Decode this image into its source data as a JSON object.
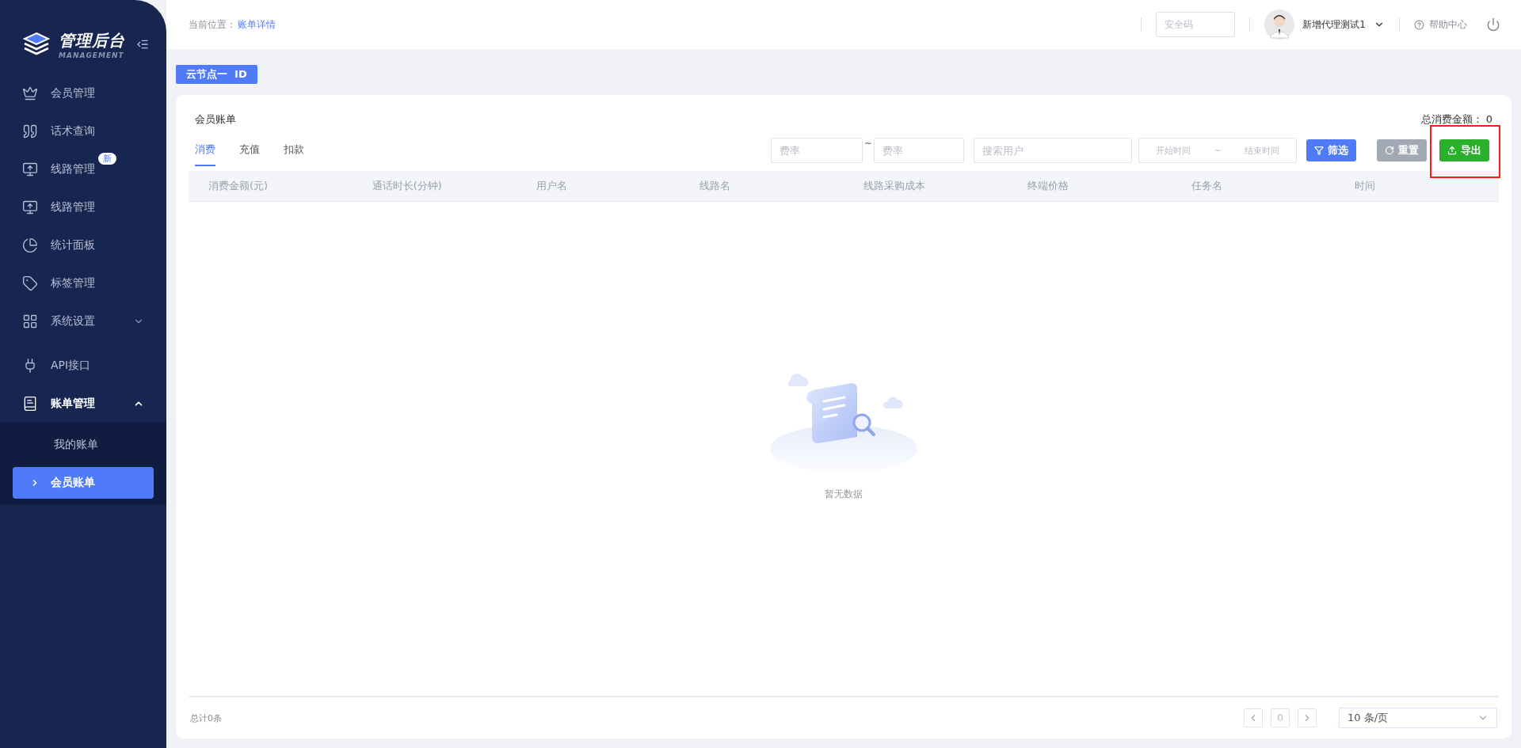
{
  "sidebar": {
    "logo": {
      "title": "管理后台",
      "subtitle": "MANAGEMENT"
    },
    "items": [
      {
        "kind": "link",
        "label": "会员管理",
        "selected": false
      },
      {
        "kind": "link",
        "label": "话术查询",
        "selected": false
      },
      {
        "kind": "link",
        "label": "线路管理",
        "badge": "新",
        "selected": false
      },
      {
        "kind": "link",
        "label": "线路管理",
        "selected": false
      },
      {
        "kind": "link",
        "label": "统计面板",
        "selected": false
      },
      {
        "kind": "link",
        "label": "标签管理",
        "selected": false
      },
      {
        "kind": "group",
        "label": "系统设置",
        "expanded": false,
        "selected": false
      },
      {
        "kind": "link",
        "label": "API接口",
        "selected": false
      },
      {
        "kind": "group",
        "label": "账单管理",
        "expanded": true,
        "selected": true,
        "children": [
          {
            "label": "我的账单",
            "selected": false
          },
          {
            "label": "会员账单",
            "selected": true
          }
        ]
      }
    ]
  },
  "header": {
    "breadcrumb_label": "当前位置：",
    "breadcrumb": "账单详情",
    "security_code": {
      "placeholder": "安全码"
    },
    "user": "新增代理测试1",
    "help": "帮助中心"
  },
  "node_tag": "云节点一  ID",
  "card": {
    "title": "会员账单",
    "total_label": "总消费金额：",
    "total": "0",
    "tabs": [
      {
        "label": "消费",
        "selected": true
      },
      {
        "label": "充值",
        "selected": false
      },
      {
        "label": "扣款",
        "selected": false
      }
    ],
    "filters": {
      "rate_min": {
        "placeholder": "费率"
      },
      "range_sep": "~",
      "rate_max": {
        "placeholder": "费率"
      },
      "user": {
        "placeholder": "搜索用户"
      },
      "start": {
        "placeholder": "开始时间"
      },
      "date_sep": "~",
      "end": {
        "placeholder": "结束时间"
      }
    },
    "buttons": [
      {
        "kind": "filter",
        "label": "筛选"
      },
      {
        "kind": "reset",
        "label": "重置"
      },
      {
        "kind": "export",
        "label": "导出",
        "highlighted": true
      }
    ],
    "table": {
      "columns": [
        "消费金额(元)",
        "通话时长(分钟)",
        "用户名",
        "线路名",
        "线路采购成本",
        "终端价格",
        "任务名",
        "时间"
      ],
      "empty_text": "暂无数据"
    },
    "footer": {
      "total": "总计0条",
      "page": "0",
      "page_size": "10 条/页"
    }
  }
}
